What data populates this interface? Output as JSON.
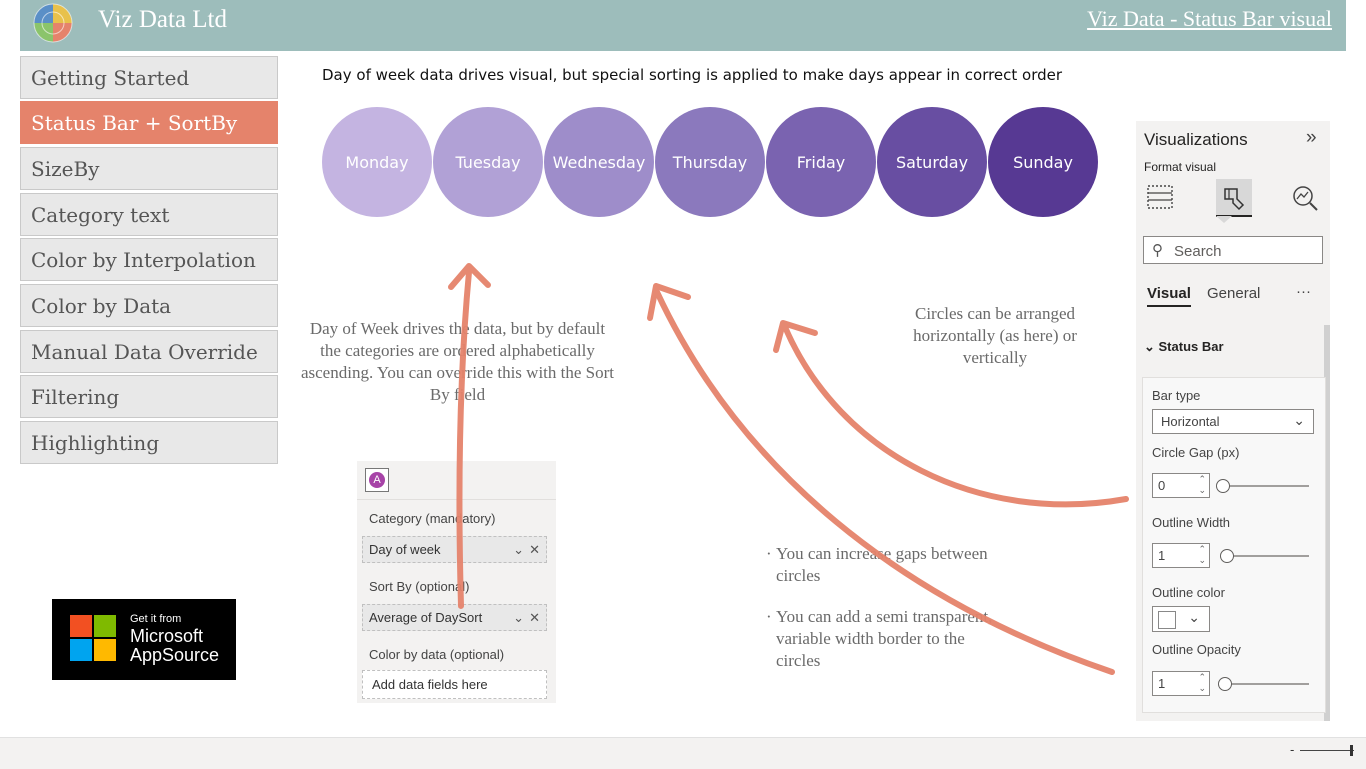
{
  "header": {
    "company": "Viz Data Ltd",
    "title_link": "Viz Data -  Status Bar visual"
  },
  "nav": {
    "items": [
      {
        "label": "Getting Started"
      },
      {
        "label": "Status Bar + SortBy",
        "active": true
      },
      {
        "label": "SizeBy"
      },
      {
        "label": "Category text"
      },
      {
        "label": "Color by Interpolation"
      },
      {
        "label": "Color by Data"
      },
      {
        "label": "Manual Data Override"
      },
      {
        "label": "Filtering"
      },
      {
        "label": "Highlighting"
      }
    ]
  },
  "main": {
    "caption": "Day of week data drives visual, but special sorting is applied to make days appear in correct order",
    "days": [
      {
        "label": "Monday",
        "color": "#c4b4e1"
      },
      {
        "label": "Tuesday",
        "color": "#b1a1d6"
      },
      {
        "label": "Wednesday",
        "color": "#9e8dca"
      },
      {
        "label": "Thursday",
        "color": "#8b79bd"
      },
      {
        "label": "Friday",
        "color": "#7a63b0"
      },
      {
        "label": "Saturday",
        "color": "#684ea2"
      },
      {
        "label": "Sunday",
        "color": "#573993"
      }
    ],
    "note_sort": "Day of Week drives the data, but by default the categories are ordered alphabetically ascending. You can override this with the Sort By field",
    "note_arrange": "Circles can be arranged horizontally (as here) or vertically",
    "bullet_gaps": "You can increase gaps between circles",
    "bullet_border": "You can add a semi transparent, variable width border to the circles",
    "arrow_color": "#e5836b"
  },
  "fields_pane": {
    "badge": "A",
    "category_label": "Category (mandatory)",
    "category_value": "Day of week",
    "sortby_label": "Sort By (optional)",
    "sortby_value": "Average of DaySort",
    "colorby_label": "Color by data (optional)",
    "colorby_placeholder": "Add data fields here"
  },
  "appsource": {
    "line1": "Get it from",
    "line2": "Microsoft",
    "line3": "AppSource"
  },
  "viz_pane": {
    "title": "Visualizations",
    "format_visual": "Format visual",
    "search_placeholder": "Search",
    "tab_visual": "Visual",
    "tab_general": "General",
    "more": "···",
    "section": "Status Bar",
    "bar_type_label": "Bar type",
    "bar_type_value": "Horizontal",
    "circle_gap_label": "Circle Gap (px)",
    "circle_gap_value": "0",
    "outline_width_label": "Outline Width",
    "outline_width_value": "1",
    "outline_color_label": "Outline color",
    "outline_opacity_label": "Outline Opacity",
    "outline_opacity_value": "1"
  },
  "bottom": {
    "zoom_minus": "-"
  }
}
